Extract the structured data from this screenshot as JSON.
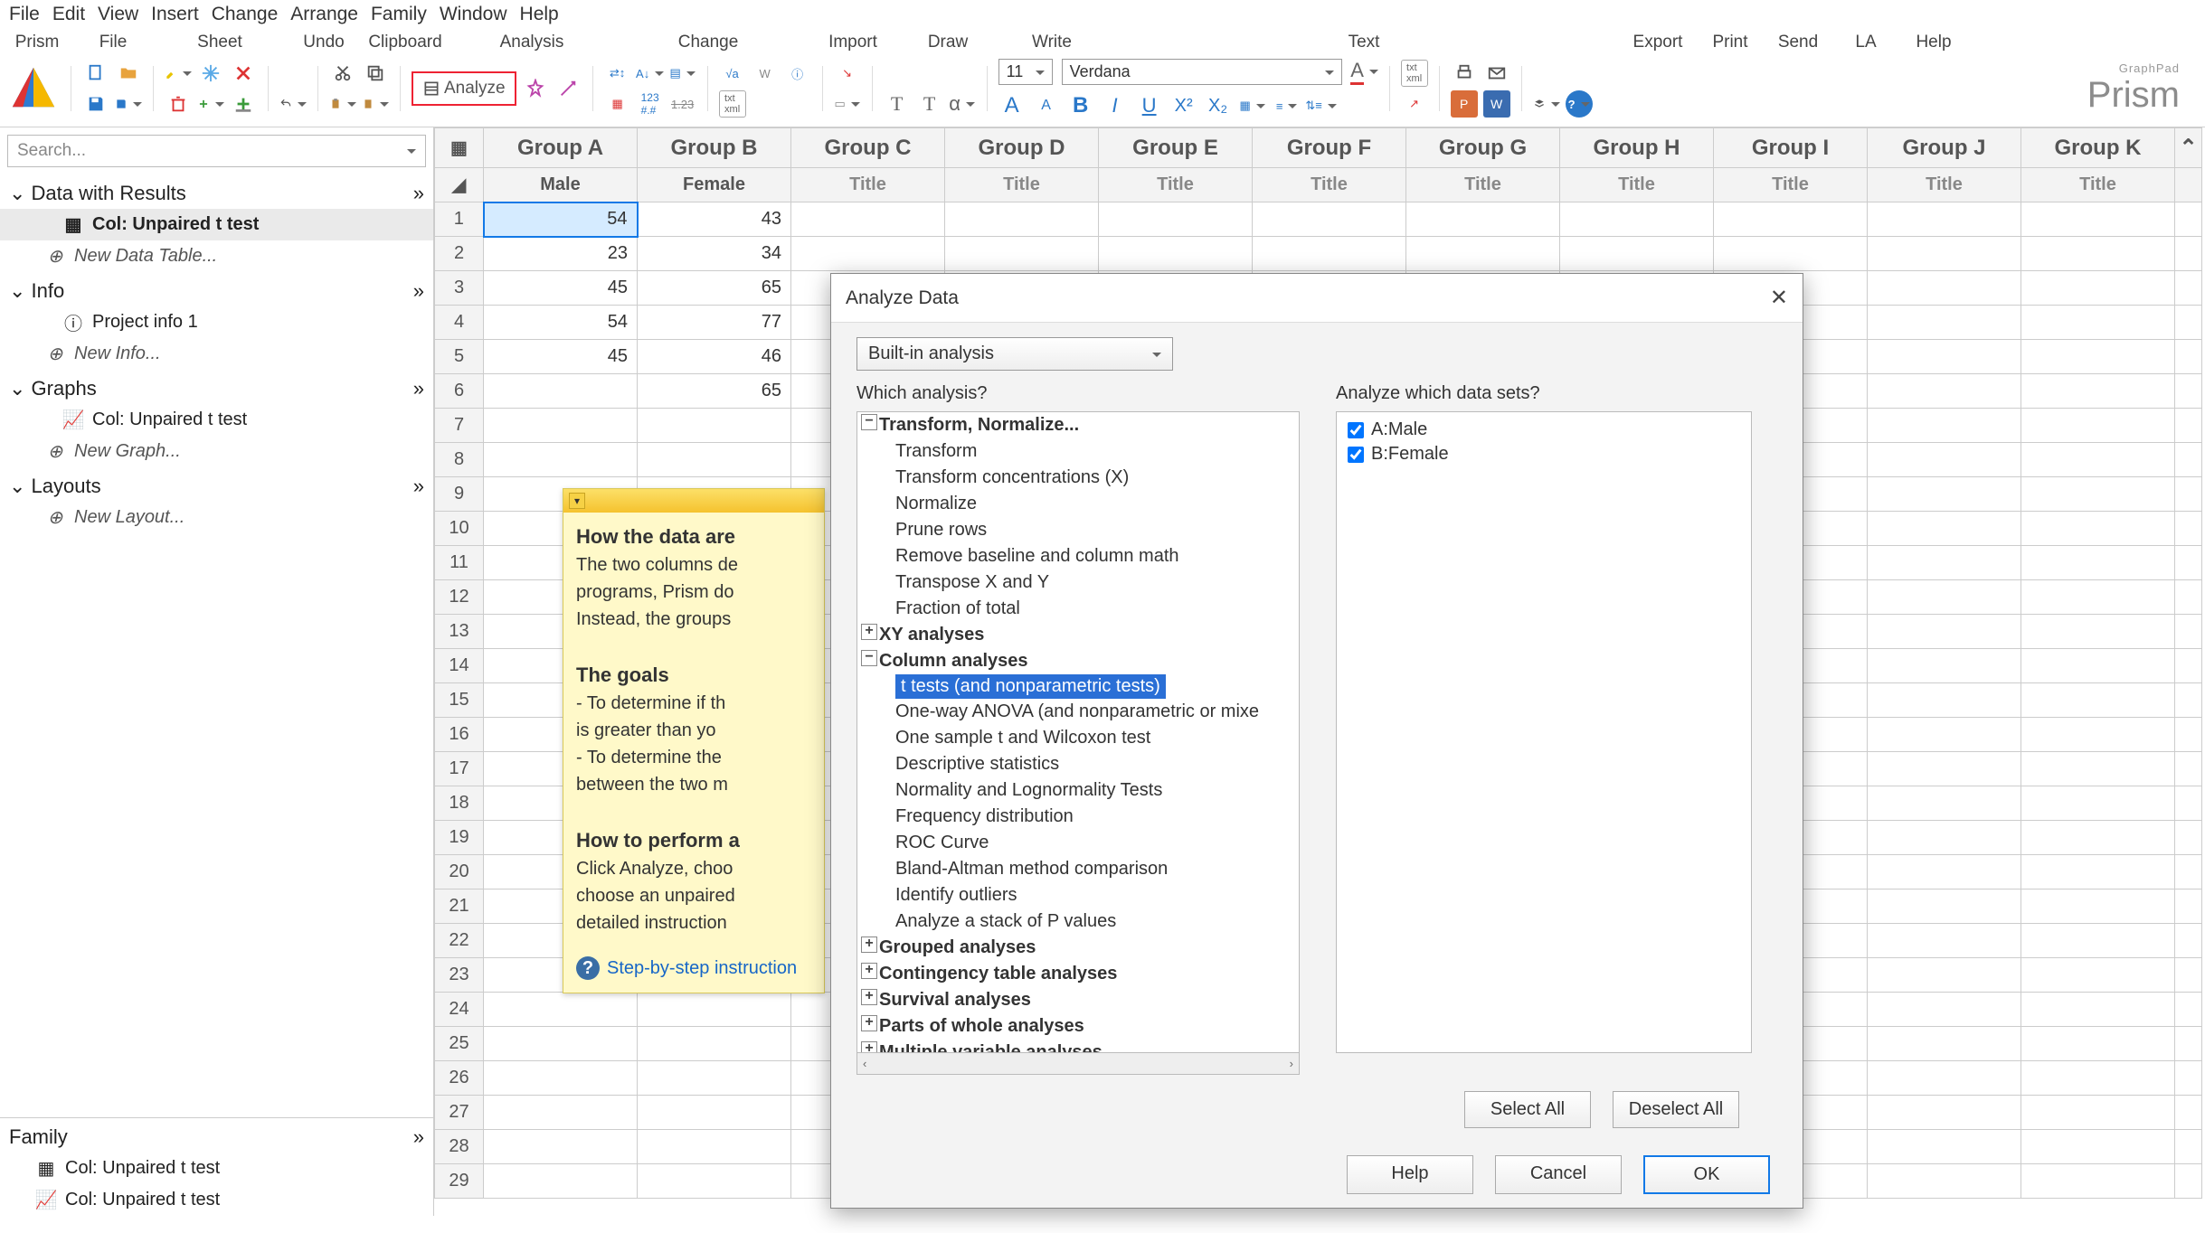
{
  "menu": [
    "File",
    "Edit",
    "View",
    "Insert",
    "Change",
    "Arrange",
    "Family",
    "Window",
    "Help"
  ],
  "ribbon_sections": {
    "prism": "Prism",
    "file": "File",
    "sheet": "Sheet",
    "undo": "Undo",
    "clipboard": "Clipboard",
    "analysis": "Analysis",
    "change": "Change",
    "import": "Import",
    "draw": "Draw",
    "write": "Write",
    "text": "Text",
    "export": "Export",
    "print": "Print",
    "send": "Send",
    "la": "LA",
    "help": "Help"
  },
  "analyze_btn": "Analyze",
  "font_size": "11",
  "font_name": "Verdana",
  "logo_small": "GraphPad",
  "logo_big": "Prism",
  "search_placeholder": "Search...",
  "sidebar": {
    "data_with_results": "Data with Results",
    "col_unpaired": "Col: Unpaired t test",
    "new_data_table": "New Data Table...",
    "info": "Info",
    "project_info": "Project info 1",
    "new_info": "New Info...",
    "graphs": "Graphs",
    "new_graph": "New Graph...",
    "layouts": "Layouts",
    "new_layout": "New Layout...",
    "family": "Family"
  },
  "groups": [
    "Group A",
    "Group B",
    "Group C",
    "Group D",
    "Group E",
    "Group F",
    "Group G",
    "Group H",
    "Group I",
    "Group J",
    "Group K"
  ],
  "titles": [
    "Male",
    "Female",
    "Title",
    "Title",
    "Title",
    "Title",
    "Title",
    "Title",
    "Title",
    "Title",
    "Title"
  ],
  "rows": [
    [
      "54",
      "43"
    ],
    [
      "23",
      "34"
    ],
    [
      "45",
      "65"
    ],
    [
      "54",
      "77"
    ],
    [
      "45",
      "46"
    ],
    [
      "",
      "65"
    ],
    [
      "",
      ""
    ],
    [
      "",
      ""
    ],
    [
      "",
      ""
    ],
    [
      "",
      ""
    ],
    [
      "",
      ""
    ],
    [
      "",
      ""
    ],
    [
      "",
      ""
    ],
    [
      "",
      ""
    ],
    [
      "",
      ""
    ],
    [
      "",
      ""
    ],
    [
      "",
      ""
    ],
    [
      "",
      ""
    ],
    [
      "",
      ""
    ],
    [
      "",
      ""
    ],
    [
      "",
      ""
    ],
    [
      "",
      ""
    ],
    [
      "",
      ""
    ],
    [
      "",
      ""
    ],
    [
      "",
      ""
    ],
    [
      "",
      ""
    ],
    [
      "",
      ""
    ],
    [
      "",
      ""
    ],
    [
      "",
      ""
    ]
  ],
  "note": {
    "h1": "How the data are",
    "l1": "The two columns de",
    "l2": "programs, Prism do",
    "l3": "Instead, the groups",
    "h2": "The goals",
    "l4": "- To determine if th",
    "l5": "  is greater than yo",
    "l6": "- To determine the ",
    "l7": "  between the two m",
    "h3": "How to perform a",
    "l8": "Click  Analyze, choo",
    "l9": "choose an unpaired",
    "l10": "detailed instruction",
    "link": "Step-by-step instruction"
  },
  "dialog": {
    "title": "Analyze Data",
    "combo": "Built-in analysis",
    "which": "Which analysis?",
    "which_ds": "Analyze which data sets?",
    "ds_a": "A:Male",
    "ds_b": "B:Female",
    "select_all": "Select All",
    "deselect_all": "Deselect All",
    "help": "Help",
    "cancel": "Cancel",
    "ok": "OK",
    "tree": {
      "transform_cat": "Transform, Normalize...",
      "transform": "Transform",
      "transform_conc": "Transform concentrations (X)",
      "normalize": "Normalize",
      "prune": "Prune rows",
      "remove_baseline": "Remove baseline and column math",
      "transpose": "Transpose X and Y",
      "fraction": "Fraction of total",
      "xy_cat": "XY analyses",
      "col_cat": "Column analyses",
      "ttests": "t tests (and nonparametric tests)",
      "anova": "One-way ANOVA (and nonparametric or mixe",
      "onesample": "One sample t and Wilcoxon test",
      "descriptive": "Descriptive statistics",
      "normality": "Normality and Lognormality Tests",
      "freq": "Frequency distribution",
      "roc": "ROC Curve",
      "bland": "Bland-Altman method comparison",
      "outliers": "Identify outliers",
      "pvalues": "Analyze a stack of P values",
      "grouped_cat": "Grouped analyses",
      "contingency_cat": "Contingency table analyses",
      "survival_cat": "Survival analyses",
      "parts_cat": "Parts of whole analyses",
      "multiple_cat": "Multiple variable analyses"
    }
  }
}
